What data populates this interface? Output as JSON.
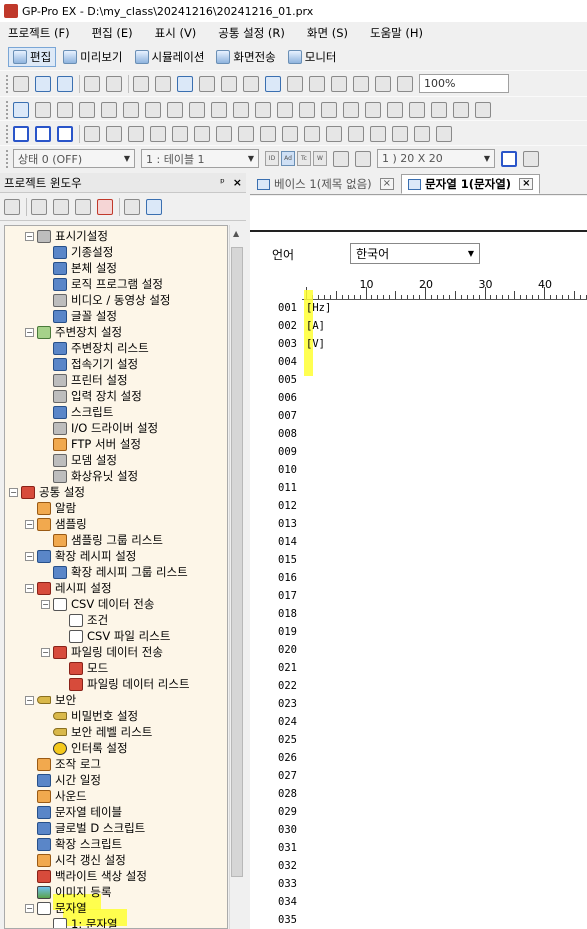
{
  "window": {
    "title": "GP-Pro EX - D:\\my_class\\20241216\\20241216_01.prx"
  },
  "menu": [
    "프로젝트 (F)",
    "편집 (E)",
    "표시 (V)",
    "공통 설정 (R)",
    "화면 (S)",
    "도움말 (H)"
  ],
  "modes": [
    {
      "label": "편집",
      "active": true,
      "icon": "edit-mode-icon"
    },
    {
      "label": "미리보기",
      "active": false,
      "icon": "preview-icon"
    },
    {
      "label": "시뮬레이션",
      "active": false,
      "icon": "simulation-icon"
    },
    {
      "label": "화면전송",
      "active": false,
      "icon": "screen-transfer-icon"
    },
    {
      "label": "모니터",
      "active": false,
      "icon": "monitor-icon"
    }
  ],
  "toolbar": {
    "zoom": "100%"
  },
  "property_bar": {
    "state": "상태 0 (OFF)",
    "table": "1 : 테이블 1",
    "size": "1 ) 20 X 20"
  },
  "project_window": {
    "title": "프로젝트 윈도우",
    "pin": "ᵖ",
    "close": "×",
    "tree": [
      {
        "label": "표시기설정",
        "level": 1,
        "expander": "−",
        "icon": "display-unit-icon",
        "style": "gray"
      },
      {
        "label": "기종설정",
        "level": 2,
        "icon": "model-settings-icon",
        "style": "blue"
      },
      {
        "label": "본체 설정",
        "level": 2,
        "icon": "unit-settings-icon",
        "style": "blue"
      },
      {
        "label": "로직 프로그램 설정",
        "level": 2,
        "icon": "logic-program-icon",
        "style": "blue"
      },
      {
        "label": "비디오 / 동영상 설정",
        "level": 2,
        "icon": "video-icon",
        "style": "gray"
      },
      {
        "label": "글꼴 설정",
        "level": 2,
        "icon": "font-icon",
        "style": "blue"
      },
      {
        "label": "주변장치 설정",
        "level": 1,
        "expander": "−",
        "icon": "peripheral-icon",
        "style": "green"
      },
      {
        "label": "주변장치 리스트",
        "level": 2,
        "icon": "peripheral-list-icon",
        "style": "blue"
      },
      {
        "label": "접속기기 설정",
        "level": 2,
        "icon": "device-connection-icon",
        "style": "blue"
      },
      {
        "label": "프린터 설정",
        "level": 2,
        "icon": "printer-icon",
        "style": "gray"
      },
      {
        "label": "입력 장치 설정",
        "level": 2,
        "icon": "input-device-icon",
        "style": "gray"
      },
      {
        "label": "스크립트",
        "level": 2,
        "icon": "script-icon",
        "style": "blue"
      },
      {
        "label": "I/O 드라이버 설정",
        "level": 2,
        "icon": "io-driver-icon",
        "style": "gray"
      },
      {
        "label": "FTP 서버 설정",
        "level": 2,
        "icon": "ftp-server-icon",
        "style": "orange"
      },
      {
        "label": "모뎀 설정",
        "level": 2,
        "icon": "modem-icon",
        "style": "gray"
      },
      {
        "label": "화상유닛 설정",
        "level": 2,
        "icon": "video-unit-icon",
        "style": "gray"
      },
      {
        "label": "공통 설정",
        "level": 0,
        "expander": "−",
        "icon": "common-settings-icon",
        "style": "red"
      },
      {
        "label": "알람",
        "level": 1,
        "icon": "alarm-icon",
        "style": "orange"
      },
      {
        "label": "샘플링",
        "level": 1,
        "expander": "−",
        "icon": "sampling-icon",
        "style": "orange"
      },
      {
        "label": "샘플링 그룹 리스트",
        "level": 2,
        "icon": "sampling-group-icon",
        "style": "orange"
      },
      {
        "label": "확장 레시피 설정",
        "level": 1,
        "expander": "−",
        "icon": "ext-recipe-icon",
        "style": "blue"
      },
      {
        "label": "확장 레시피 그룹 리스트",
        "level": 2,
        "icon": "ext-recipe-group-icon",
        "style": "blue"
      },
      {
        "label": "레시피 설정",
        "level": 1,
        "expander": "−",
        "icon": "recipe-icon",
        "style": "red"
      },
      {
        "label": "CSV 데이터 전송",
        "level": 2,
        "expander": "−",
        "icon": "csv-transfer-icon",
        "style": "doc"
      },
      {
        "label": "조건",
        "level": 3,
        "icon": "condition-icon",
        "style": "doc"
      },
      {
        "label": "CSV 파일 리스트",
        "level": 3,
        "icon": "csv-file-list-icon",
        "style": "doc"
      },
      {
        "label": "파일링 데이터 전송",
        "level": 2,
        "expander": "−",
        "icon": "filing-transfer-icon",
        "style": "red"
      },
      {
        "label": "모드",
        "level": 3,
        "icon": "mode-icon",
        "style": "red"
      },
      {
        "label": "파일링 데이터 리스트",
        "level": 3,
        "icon": "filing-list-icon",
        "style": "red"
      },
      {
        "label": "보안",
        "level": 1,
        "expander": "−",
        "icon": "security-key-icon",
        "style": "key"
      },
      {
        "label": "비밀번호 설정",
        "level": 2,
        "icon": "password-key-icon",
        "style": "key"
      },
      {
        "label": "보안 레벨 리스트",
        "level": 2,
        "icon": "security-level-key-icon",
        "style": "key"
      },
      {
        "label": "인터록 설정",
        "level": 2,
        "icon": "interlock-info-icon",
        "style": "info"
      },
      {
        "label": "조작 로그",
        "level": 1,
        "icon": "operation-log-icon",
        "style": "orange"
      },
      {
        "label": "시간 일정",
        "level": 1,
        "icon": "schedule-icon",
        "style": "blue"
      },
      {
        "label": "사운드",
        "level": 1,
        "icon": "sound-icon",
        "style": "orange"
      },
      {
        "label": "문자열 테이블",
        "level": 1,
        "icon": "string-table-icon",
        "style": "blue"
      },
      {
        "label": "글로벌 D 스크립트",
        "level": 1,
        "icon": "global-script-icon",
        "style": "blue"
      },
      {
        "label": "확장 스크립트",
        "level": 1,
        "icon": "ext-script-icon",
        "style": "blue"
      },
      {
        "label": "시각 갱신 설정",
        "level": 1,
        "icon": "time-update-icon",
        "style": "orange"
      },
      {
        "label": "백라이트 색상 설정",
        "level": 1,
        "icon": "backlight-icon",
        "style": "red"
      },
      {
        "label": "이미지 등록",
        "level": 1,
        "icon": "image-register-icon",
        "style": "img"
      },
      {
        "label": "문자열",
        "level": 1,
        "expander": "−",
        "icon": "string-icon",
        "style": "doc"
      },
      {
        "label": "1: 문자열",
        "level": 2,
        "icon": "string-item-icon",
        "style": "doc"
      }
    ]
  },
  "tabs": [
    {
      "label": "베이스 1(제목 없음)",
      "active": false,
      "close": "×"
    },
    {
      "label": "문자열 1(문자열)",
      "active": true,
      "close": "×"
    }
  ],
  "editor": {
    "language_label": "언어",
    "language_value": "한국어",
    "ruler_labels": [
      "10",
      "20",
      "30",
      "40"
    ],
    "lines": [
      "001",
      "002",
      "003",
      "004",
      "005",
      "006",
      "007",
      "008",
      "009",
      "010",
      "011",
      "012",
      "013",
      "014",
      "015",
      "016",
      "017",
      "018",
      "019",
      "020",
      "021",
      "022",
      "023",
      "024",
      "025",
      "026",
      "027",
      "028",
      "029",
      "030",
      "031",
      "032",
      "033",
      "034",
      "035"
    ],
    "texts": [
      "[Hz]",
      "[A]",
      "[V]"
    ]
  },
  "colors": {
    "highlight": "#ffff33",
    "tree_bg": "#fdf6e8",
    "active_mode_bg": "#dde9f7"
  }
}
